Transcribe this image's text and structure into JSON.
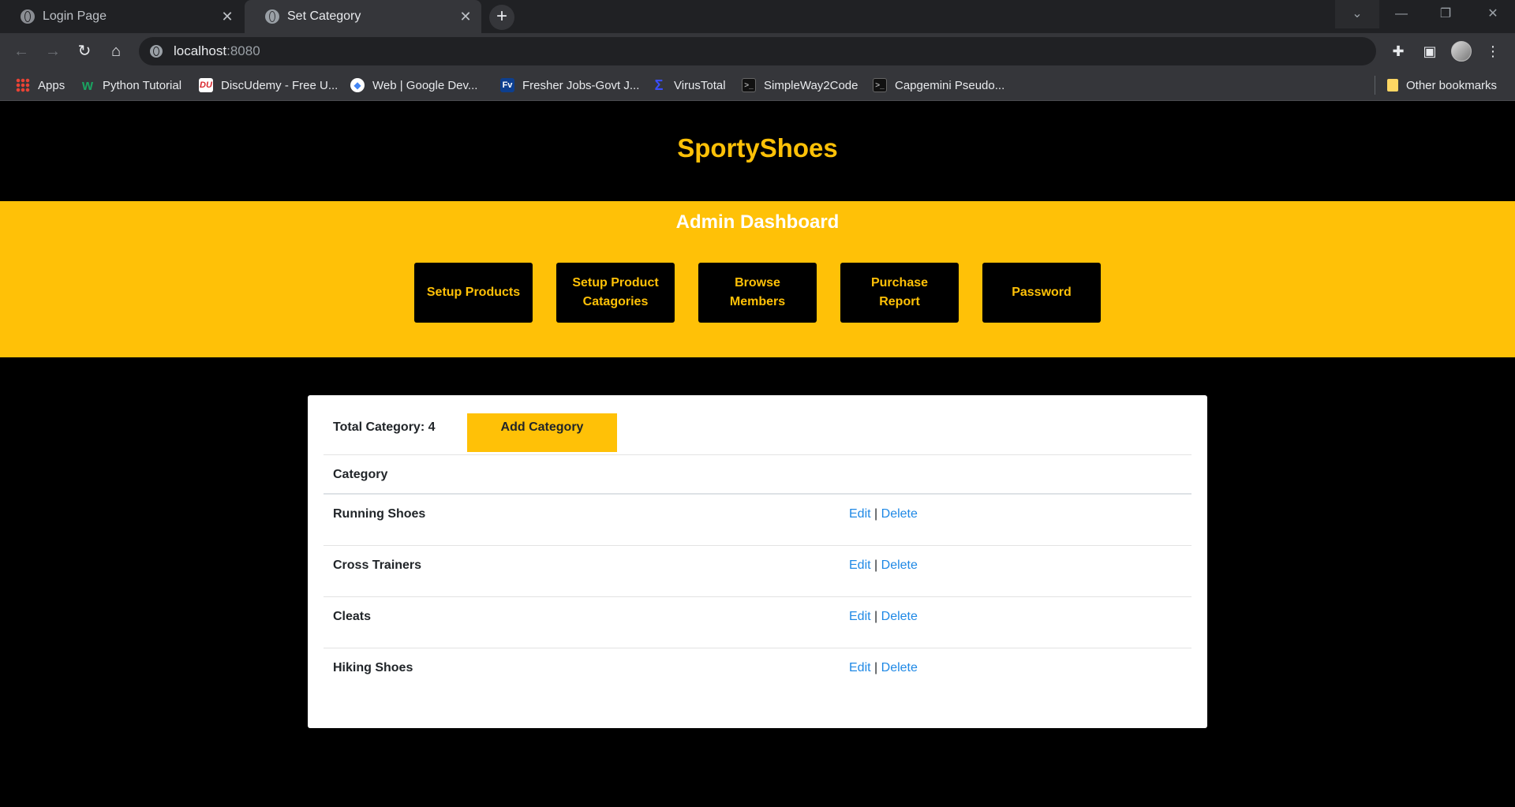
{
  "browser": {
    "tabs": [
      {
        "title": "Login Page",
        "active": false
      },
      {
        "title": "Set Category",
        "active": true
      }
    ],
    "url_host": "localhost",
    "url_port": ":8080",
    "bookmarks": [
      {
        "label": "Apps",
        "icon": "apps-grid-icon"
      },
      {
        "label": "Python Tutorial",
        "icon": "python-tutorial-favicon"
      },
      {
        "label": "DiscUdemy - Free U...",
        "icon": "discudemy-favicon"
      },
      {
        "label": "Web  |  Google Dev...",
        "icon": "google-dev-favicon"
      },
      {
        "label": "Fresher Jobs-Govt J...",
        "icon": "fresher-jobs-favicon"
      },
      {
        "label": "VirusTotal",
        "icon": "virustotal-favicon"
      },
      {
        "label": "SimpleWay2Code",
        "icon": "simpleway2code-favicon"
      },
      {
        "label": "Capgemini Pseudo...",
        "icon": "capgemini-favicon"
      }
    ],
    "other_bookmarks": "Other bookmarks"
  },
  "site": {
    "brand": "SportyShoes",
    "brand_color": "#ffc107"
  },
  "dashboard": {
    "title": "Admin Dashboard",
    "buttons": [
      {
        "label": "Setup Products"
      },
      {
        "label": "Setup Product Catagories"
      },
      {
        "label": "Browse Members"
      },
      {
        "label": "Purchase Report"
      },
      {
        "label": "Password"
      }
    ]
  },
  "categories": {
    "total_label": "Total Category: 4",
    "add_label": "Add Category",
    "column_header": "Category",
    "edit_label": "Edit",
    "separator": "|",
    "delete_label": "Delete",
    "rows": [
      {
        "name": "Running Shoes"
      },
      {
        "name": "Cross Trainers"
      },
      {
        "name": "Cleats"
      },
      {
        "name": "Hiking Shoes"
      }
    ]
  }
}
